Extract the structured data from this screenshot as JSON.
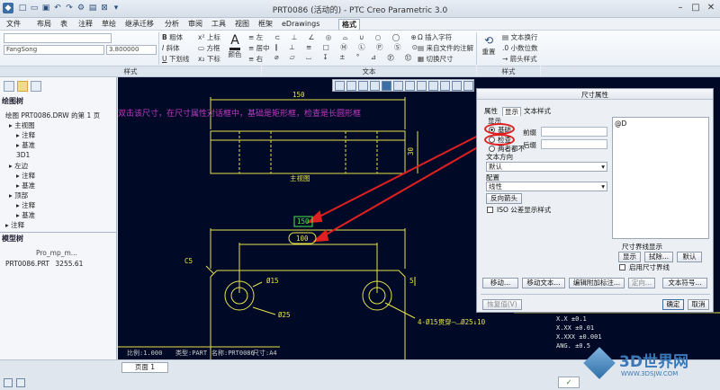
{
  "window": {
    "title": "PRT0086 (活动的) - PTC Creo Parametric 3.0"
  },
  "menu": {
    "items": [
      "文件",
      "布局",
      "表",
      "注释",
      "草绘",
      "继承迁移",
      "分析",
      "审阅",
      "工具",
      "视图",
      "框架",
      "eDrawings",
      "格式"
    ],
    "active": "格式"
  },
  "ribbon": {
    "style_label": "样式",
    "text_label": "文本",
    "style_group_label": "样式",
    "font_value": "FangSong",
    "size_value": "3.800000",
    "bold": "粗体",
    "italic": "斜体",
    "underline": "下划线",
    "superscript": "上标",
    "box": "方框",
    "subscript": "下标",
    "align_left": "左",
    "align_center": "居中",
    "align_right": "右",
    "color": "颜色",
    "insert_char": "插入字符",
    "from_file": "来自文件的注解",
    "toggle_text": "切换尺寸",
    "text_wrap": "文本换行",
    "decimal": "小数位数",
    "arrow_style": "箭头样式",
    "reset": "重置"
  },
  "leftpanel": {
    "tree_header": "绘图树",
    "tree_items": [
      "绘图 PRT0086.DRW 的第 1 页",
      "主视图",
      "注释",
      "基准",
      "3D1",
      "左边",
      "注释",
      "基准",
      "顶部",
      "注释",
      "基准",
      "注释"
    ],
    "model_header": "模型树",
    "model_col": "Pro_mp_m...",
    "model_item": "PRT0086.PRT",
    "model_value": "3255.61"
  },
  "annotation": {
    "text": "双击该尺寸，在尺寸属性对话框中，基础是矩形框，检查是长圆形框"
  },
  "drawing": {
    "dim_150_top": "150",
    "dim_30": "30",
    "view_label": "主视图",
    "dim_150_box": "150",
    "dim_100_oval": "100",
    "chamfer": "C5",
    "hole_15": "Ø15",
    "hole_25": "Ø25",
    "hole_note": "4-Ø15贯穿—⌴Ø25↓10",
    "dim_5": "5",
    "scale_text": "比例:1.000",
    "type_text": "类型:PART",
    "name_text": "名称:PRT0086",
    "size_text": "尺寸:A4",
    "tol_lines": [
      "X.X    ±0.1",
      "X.XX   ±0.01",
      "X.XXX  ±0.001",
      "ANG.   ±0.5"
    ]
  },
  "statusbar": {
    "page_label": "页面 1",
    "right_icon": "checkmark-icon"
  },
  "dialog": {
    "title": "尺寸属性",
    "tabs": [
      "属性",
      "显示",
      "文本样式"
    ],
    "active_tab": "显示",
    "section_display": "显示",
    "radio_basic": "基础",
    "radio_inspect": "检查",
    "radio_neither": "两者都不",
    "prefix_label": "前缀",
    "suffix_label": "后缀",
    "text_direction_label": "文本方向",
    "text_direction_value": "默认",
    "config_label": "配置",
    "config_value": "线性",
    "flip_arrows": "反向箭头",
    "iso_check": "ISO 公差显示样式",
    "text_area_value": "@D",
    "extension_label": "尺寸界线显示",
    "btn_show": "显示",
    "btn_erase": "拭除...",
    "btn_default": "默认",
    "use_dim_ext": "启用尺寸界线",
    "btn_move": "移动...",
    "btn_move_text": "移动文本...",
    "btn_edit_attach": "编辑附加标注...",
    "btn_orient": "定向...",
    "btn_text_symbol": "文本符号...",
    "btn_restore": "恢复值(V)",
    "btn_ok": "确定",
    "btn_cancel": "取消"
  },
  "watermark": {
    "brand": "3D世界网",
    "url": "WWW.3DSJW.COM"
  },
  "colors": {
    "canvas_bg": "#000a26",
    "drawing_yellow": "#e8e24a",
    "leader_red": "#e02020",
    "annotation_purple": "#c038c0",
    "dim_green": "#4ee84e"
  }
}
